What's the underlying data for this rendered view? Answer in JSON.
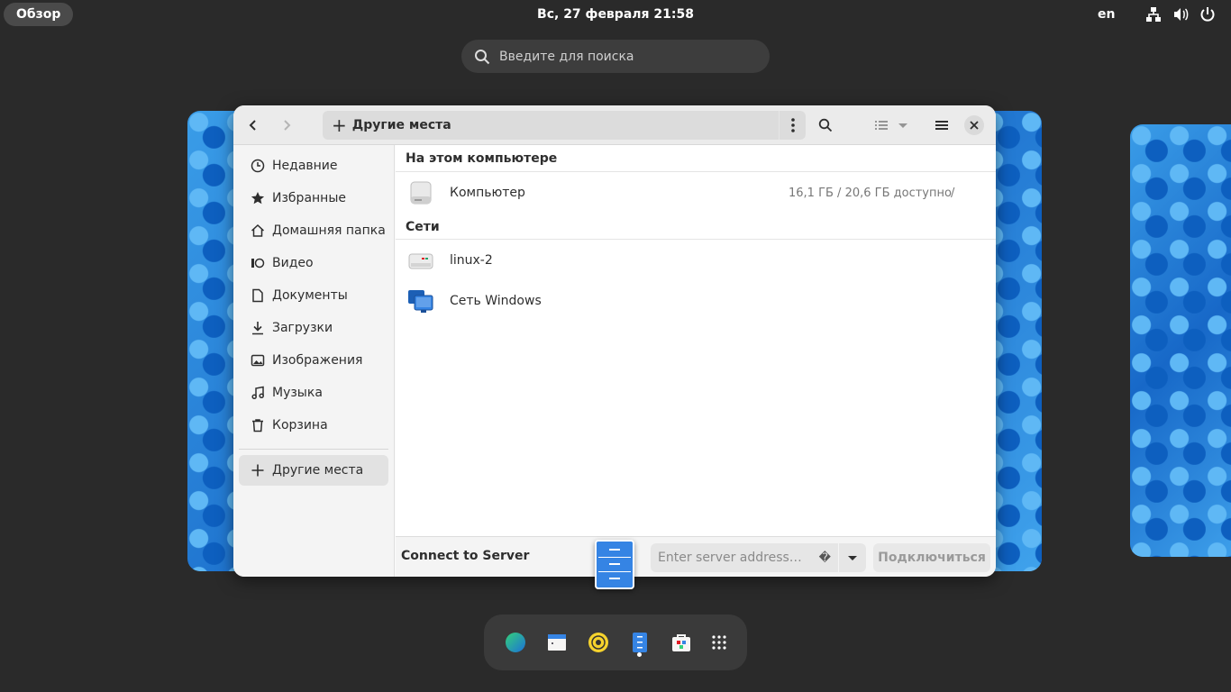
{
  "topbar": {
    "overview_label": "Обзор",
    "clock_label": "Вс, 27 февраля  21:58",
    "language_label": "en"
  },
  "search": {
    "placeholder": "Введите для поиска"
  },
  "window": {
    "path_label": "Другие места",
    "sidebar": {
      "items": [
        {
          "label": "Недавние",
          "icon": "clock-icon"
        },
        {
          "label": "Избранные",
          "icon": "star-icon"
        },
        {
          "label": "Домашняя папка",
          "icon": "home-icon"
        },
        {
          "label": "Видео",
          "icon": "video-icon"
        },
        {
          "label": "Документы",
          "icon": "document-icon"
        },
        {
          "label": "Загрузки",
          "icon": "download-icon"
        },
        {
          "label": "Изображения",
          "icon": "image-icon"
        },
        {
          "label": "Музыка",
          "icon": "music-icon"
        },
        {
          "label": "Корзина",
          "icon": "trash-icon"
        }
      ],
      "other_places_label": "Другие места"
    },
    "sections": {
      "this_computer_title": "На этом компьютере",
      "networks_title": "Сети"
    },
    "computer": {
      "name": "Компьютер",
      "space": "16,1 ГБ / 20,6 ГБ доступно",
      "mount": "/"
    },
    "networks": [
      {
        "name": "linux-2",
        "icon": "network-server-icon"
      },
      {
        "name": "Сеть Windows",
        "icon": "windows-network-icon"
      }
    ],
    "connect": {
      "label": "Connect to Server",
      "address_placeholder": "Enter server address…",
      "address_glyph": "�",
      "button_label": "Подключиться"
    }
  },
  "dock": {
    "apps": [
      "web-browser-icon",
      "text-editor-icon",
      "music-player-icon",
      "files-icon",
      "software-center-icon",
      "app-grid-icon"
    ]
  },
  "colors": {
    "accent": "#3584e4",
    "background": "#2a2a2a"
  }
}
